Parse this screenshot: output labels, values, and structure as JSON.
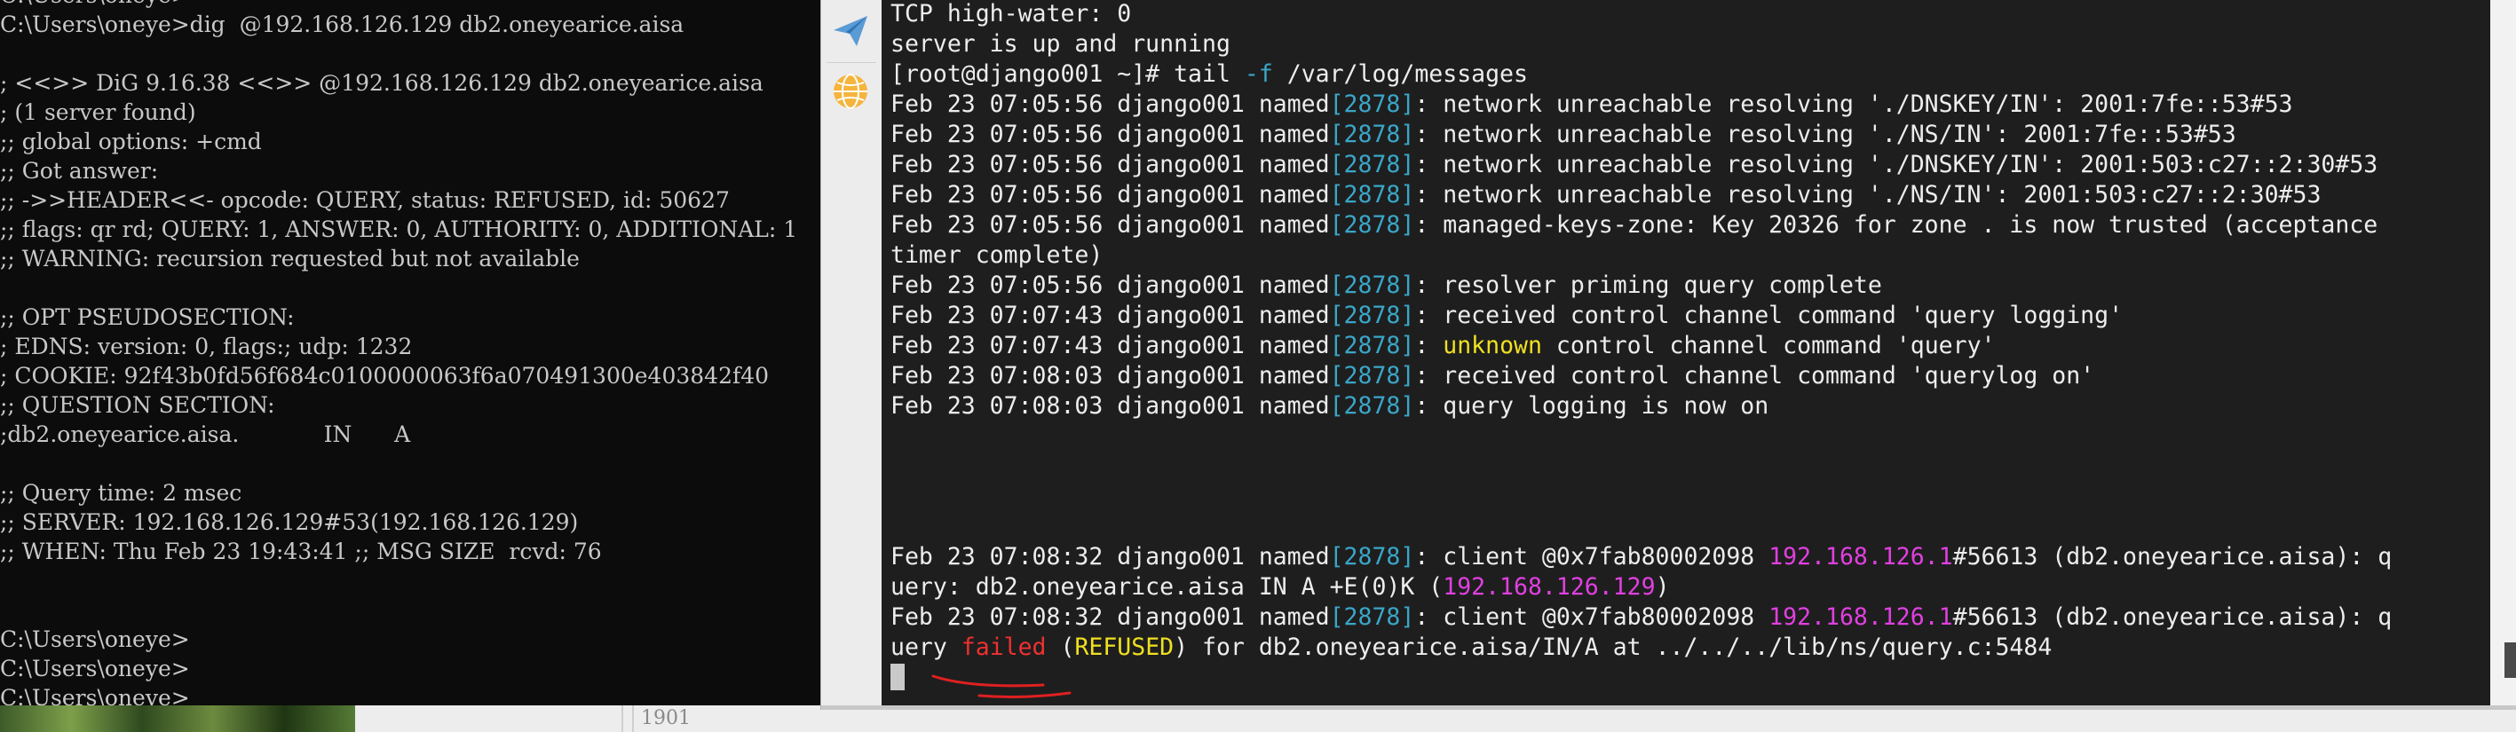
{
  "cmd_window": {
    "lines": [
      "C:\\Users\\oneye>",
      "C:\\Users\\oneye>dig  @192.168.126.129 db2.oneyearice.aisa",
      "",
      "; <<>> DiG 9.16.38 <<>> @192.168.126.129 db2.oneyearice.aisa",
      "; (1 server found)",
      ";; global options: +cmd",
      ";; Got answer:",
      ";; ->>HEADER<<- opcode: QUERY, status: REFUSED, id: 50627",
      ";; flags: qr rd; QUERY: 1, ANSWER: 0, AUTHORITY: 0, ADDITIONAL: 1",
      ";; WARNING: recursion requested but not available",
      "",
      ";; OPT PSEUDOSECTION:",
      "; EDNS: version: 0, flags:; udp: 1232",
      "; COOKIE: 92f43b0fd56f684c0100000063f6a070491300e403842f40",
      ";; QUESTION SECTION:",
      ";db2.oneyearice.aisa.            IN      A",
      "",
      ";; Query time: 2 msec",
      ";; SERVER: 192.168.126.129#53(192.168.126.129)",
      ";; WHEN: Thu Feb 23 19:43:41 ;; MSG SIZE  rcvd: 76",
      "",
      "",
      "C:\\Users\\oneye>",
      "C:\\Users\\oneye>",
      "C:\\Users\\oneye>"
    ]
  },
  "desktop": {
    "partial_number": "1901"
  },
  "terminal": {
    "sidebar_icons": [
      "send-icon",
      "globe-icon"
    ],
    "lines": [
      [
        {
          "t": "TCP high-water: 0"
        }
      ],
      [
        {
          "t": "server is up and running"
        }
      ],
      [
        {
          "t": "[root@django001 ~]# tail "
        },
        {
          "t": "-f",
          "c": "c-pid"
        },
        {
          "t": " /var/log/messages"
        }
      ],
      [
        {
          "t": "Feb 23 07:05:56 django001 named"
        },
        {
          "t": "[2878]",
          "c": "c-pid"
        },
        {
          "t": ": network unreachable resolving './DNSKEY/IN': 2001:7fe::53#53"
        }
      ],
      [
        {
          "t": "Feb 23 07:05:56 django001 named"
        },
        {
          "t": "[2878]",
          "c": "c-pid"
        },
        {
          "t": ": network unreachable resolving './NS/IN': 2001:7fe::53#53"
        }
      ],
      [
        {
          "t": "Feb 23 07:05:56 django001 named"
        },
        {
          "t": "[2878]",
          "c": "c-pid"
        },
        {
          "t": ": network unreachable resolving './DNSKEY/IN': 2001:503:c27::2:30#53"
        }
      ],
      [
        {
          "t": "Feb 23 07:05:56 django001 named"
        },
        {
          "t": "[2878]",
          "c": "c-pid"
        },
        {
          "t": ": network unreachable resolving './NS/IN': 2001:503:c27::2:30#53"
        }
      ],
      [
        {
          "t": "Feb 23 07:05:56 django001 named"
        },
        {
          "t": "[2878]",
          "c": "c-pid"
        },
        {
          "t": ": managed-keys-zone: Key 20326 for zone . is now trusted (acceptance"
        }
      ],
      [
        {
          "t": "timer complete)"
        }
      ],
      [
        {
          "t": "Feb 23 07:05:56 django001 named"
        },
        {
          "t": "[2878]",
          "c": "c-pid"
        },
        {
          "t": ": resolver priming query complete"
        }
      ],
      [
        {
          "t": "Feb 23 07:07:43 django001 named"
        },
        {
          "t": "[2878]",
          "c": "c-pid"
        },
        {
          "t": ": received control channel command 'query logging'"
        }
      ],
      [
        {
          "t": "Feb 23 07:07:43 django001 named"
        },
        {
          "t": "[2878]",
          "c": "c-pid"
        },
        {
          "t": ": "
        },
        {
          "t": "unknown",
          "c": "c-warn"
        },
        {
          "t": " control channel command 'query'"
        }
      ],
      [
        {
          "t": "Feb 23 07:08:03 django001 named"
        },
        {
          "t": "[2878]",
          "c": "c-pid"
        },
        {
          "t": ": received control channel command 'querylog on'"
        }
      ],
      [
        {
          "t": "Feb 23 07:08:03 django001 named"
        },
        {
          "t": "[2878]",
          "c": "c-pid"
        },
        {
          "t": ": query logging is now on"
        }
      ],
      [],
      [],
      [],
      [],
      [
        {
          "t": "Feb 23 07:08:32 django001 named"
        },
        {
          "t": "[2878]",
          "c": "c-pid"
        },
        {
          "t": ": client @0x7fab80002098 "
        },
        {
          "t": "192.168.126.1",
          "c": "c-ip"
        },
        {
          "t": "#56613 (db2.oneyearice.aisa): q"
        }
      ],
      [
        {
          "t": "uery: db2.oneyearice.aisa IN A +E(0)K ("
        },
        {
          "t": "192.168.126.129",
          "c": "c-ip"
        },
        {
          "t": ")"
        }
      ],
      [
        {
          "t": "Feb 23 07:08:32 django001 named"
        },
        {
          "t": "[2878]",
          "c": "c-pid"
        },
        {
          "t": ": client @0x7fab80002098 "
        },
        {
          "t": "192.168.126.1",
          "c": "c-ip"
        },
        {
          "t": "#56613 (db2.oneyearice.aisa): q"
        }
      ],
      [
        {
          "t": "uery "
        },
        {
          "t": "failed",
          "c": "c-red"
        },
        {
          "t": " ("
        },
        {
          "t": "REFUSED",
          "c": "c-warn"
        },
        {
          "t": ") for db2.oneyearice.aisa/IN/A at ../../../lib/ns/query.c:5484"
        }
      ]
    ],
    "colors": {
      "background": "#1e1e1e",
      "text": "#ededed",
      "pid": "#3aa6c8",
      "ip": "#e040e0",
      "warning": "#f0e020",
      "error": "#f03030",
      "annotation": "#e02020"
    }
  }
}
